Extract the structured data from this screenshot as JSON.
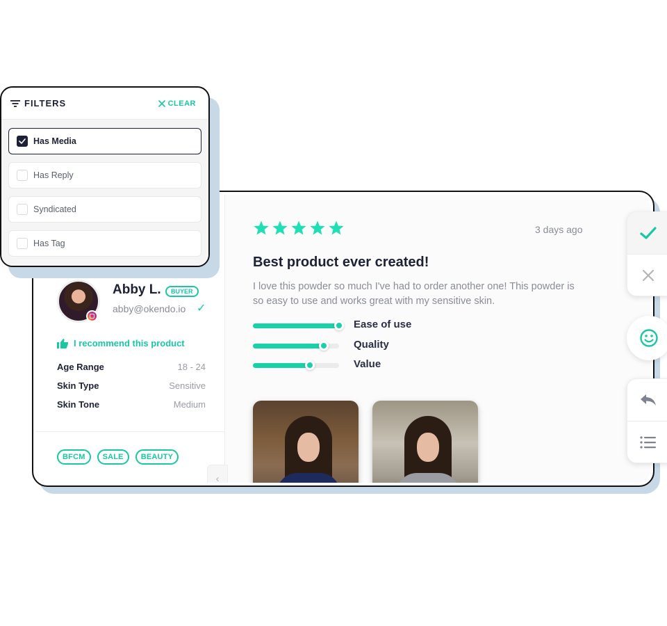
{
  "filters": {
    "title": "FILTERS",
    "clear_label": "CLEAR",
    "options": [
      {
        "label": "Has Media",
        "checked": true
      },
      {
        "label": "Has Reply",
        "checked": false
      },
      {
        "label": "Syndicated",
        "checked": false
      },
      {
        "label": "Has Tag",
        "checked": false
      }
    ]
  },
  "reviewer": {
    "name": "Abby L.",
    "badge": "BUYER",
    "email": "abby@okendo.io",
    "social_icon": "instagram-icon",
    "recommend_text": "I recommend this product",
    "attributes": [
      {
        "label": "Age Range",
        "value": "18 - 24"
      },
      {
        "label": "Skin Type",
        "value": "Sensitive"
      },
      {
        "label": "Skin Tone",
        "value": "Medium"
      }
    ],
    "tags": [
      "BFCM",
      "SALE",
      "BEAUTY"
    ]
  },
  "review": {
    "rating": 5,
    "rating_max": 5,
    "time_ago": "3 days ago",
    "title": "Best product ever created!",
    "body": "I love this powder so much I've had to order another one! This powder is so easy to use and works great with my sensitive skin.",
    "attribute_ratings": [
      {
        "label": "Ease of use",
        "value": 1.0
      },
      {
        "label": "Quality",
        "value": 0.82
      },
      {
        "label": "Value",
        "value": 0.66
      }
    ],
    "media_count": 2
  },
  "actions": [
    {
      "name": "approve",
      "icon": "check-icon"
    },
    {
      "name": "reject",
      "icon": "close-icon"
    },
    {
      "name": "sentiment",
      "icon": "smiley-icon"
    },
    {
      "name": "reply",
      "icon": "reply-icon"
    },
    {
      "name": "details",
      "icon": "list-icon"
    }
  ],
  "colors": {
    "accent": "#19c7a3",
    "dark": "#1d2136",
    "shadow_blue": "#c7d8e6"
  }
}
